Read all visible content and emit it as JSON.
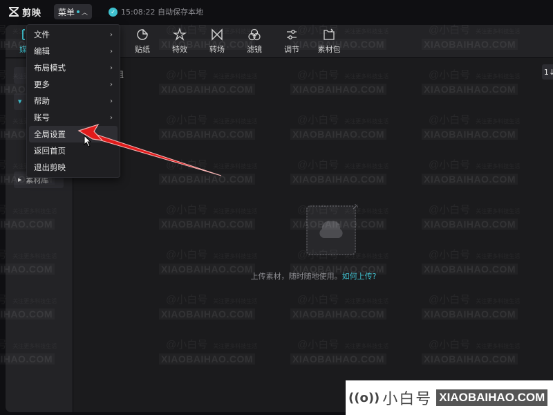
{
  "app": {
    "name": "剪映",
    "menu_button_label": "菜单",
    "save_status": "15:08:22 自动保存本地"
  },
  "toolbar": {
    "tools": [
      {
        "id": "media",
        "label": "媒体",
        "icon": "media-icon",
        "active": true
      },
      {
        "id": "sticker",
        "label": "贴纸",
        "icon": "sticker-icon"
      },
      {
        "id": "effects",
        "label": "特效",
        "icon": "effects-icon"
      },
      {
        "id": "transition",
        "label": "转场",
        "icon": "transition-icon"
      },
      {
        "id": "filter",
        "label": "滤镜",
        "icon": "filter-icon"
      },
      {
        "id": "adjust",
        "label": "调节",
        "icon": "adjust-icon"
      },
      {
        "id": "material-pack",
        "label": "素材包",
        "icon": "material-pack-icon"
      }
    ]
  },
  "sidebar": {
    "items": [
      {
        "label": "素材库",
        "icon": "caret-right-icon"
      }
    ]
  },
  "content": {
    "group_label_partial": "组",
    "sort_button_label": "1↓",
    "upload_hint": "上传素材，随时随地使用。",
    "upload_link": "如何上传?"
  },
  "dropdown_menu": {
    "items": [
      {
        "label": "文件",
        "has_submenu": true
      },
      {
        "label": "编辑",
        "has_submenu": true
      },
      {
        "label": "布局模式",
        "has_submenu": true
      },
      {
        "label": "更多",
        "has_submenu": true
      },
      {
        "label": "帮助",
        "has_submenu": true
      },
      {
        "label": "账号",
        "has_submenu": true
      },
      {
        "label": "全局设置",
        "has_submenu": false,
        "hovered": true
      },
      {
        "label": "返回首页",
        "has_submenu": false
      },
      {
        "label": "退出剪映",
        "has_submenu": false
      }
    ],
    "submenu_arrow": "›"
  },
  "watermark": {
    "at_text": "@小白号",
    "sub_text": "关注更多科技生活",
    "url_text": "XIAOBAIHAO.COM"
  },
  "brand_banner": {
    "icon": "((o))",
    "name": "小白号",
    "url": "XIAOBAIHAO.COM"
  },
  "colors": {
    "accent": "#3fc1cf",
    "annotation_arrow": "#e01b1b",
    "background": "#1b1b1d",
    "panel": "#232326"
  }
}
